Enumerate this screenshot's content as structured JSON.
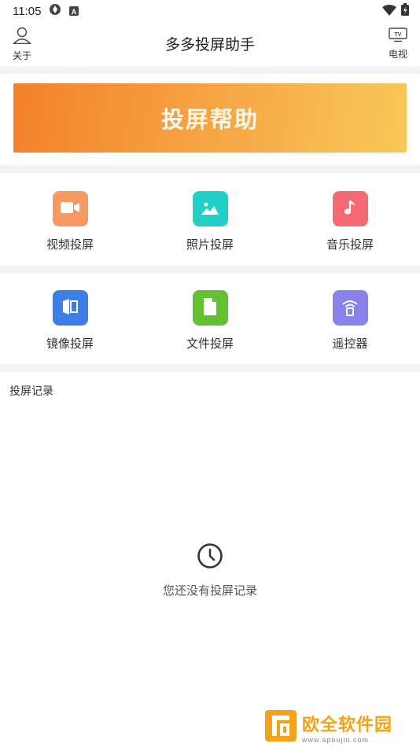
{
  "status": {
    "time": "11:05"
  },
  "header": {
    "title": "多多投屏助手",
    "about_label": "关于",
    "tv_label": "电视"
  },
  "banner": {
    "label": "投屏帮助"
  },
  "grid": {
    "row1": [
      {
        "label": "视频投屏",
        "icon": "video-icon",
        "color": "#f79a62"
      },
      {
        "label": "照片投屏",
        "icon": "photo-icon",
        "color": "#21d0c7"
      },
      {
        "label": "音乐投屏",
        "icon": "music-icon",
        "color": "#f46a72"
      }
    ],
    "row2": [
      {
        "label": "镜像投屏",
        "icon": "mirror-icon",
        "color": "#3d7fe6"
      },
      {
        "label": "文件投屏",
        "icon": "file-icon",
        "color": "#63c131"
      },
      {
        "label": "遥控器",
        "icon": "remote-icon",
        "color": "#8a82ea"
      }
    ]
  },
  "records": {
    "title": "投屏记录",
    "empty_text": "您还没有投屏记录"
  },
  "watermark": {
    "brand": "欧全软件园",
    "url": "www.apoujin.com"
  }
}
